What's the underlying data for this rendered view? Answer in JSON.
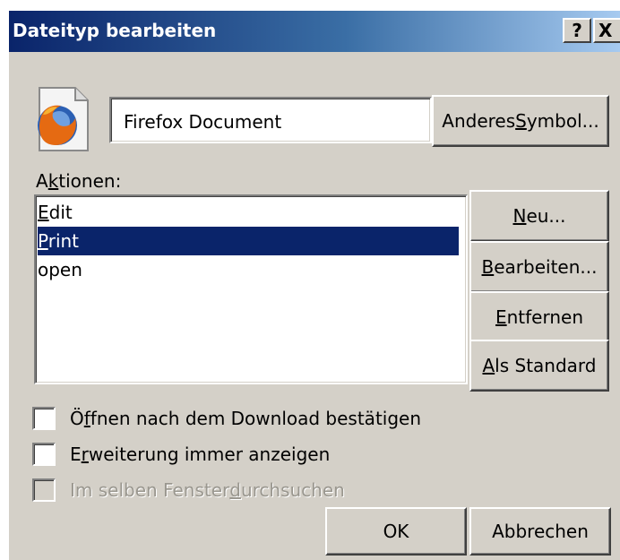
{
  "window": {
    "title": "Dateityp bearbeiten",
    "help_label": "?",
    "close_label": "X"
  },
  "file_type": {
    "icon": "firefox-icon",
    "description": "Firefox Document",
    "change_icon_button": {
      "pre": "Anderes ",
      "accel": "S",
      "post": "ymbol..."
    }
  },
  "actions": {
    "label": {
      "pre": "A",
      "accel": "k",
      "post": "tionen:"
    },
    "items": [
      {
        "accel": "E",
        "rest": "dit",
        "selected": false
      },
      {
        "accel": "P",
        "rest": "rint",
        "selected": true
      },
      {
        "accel": "",
        "rest": "open",
        "selected": false
      }
    ]
  },
  "side_buttons": {
    "new": {
      "pre": "",
      "accel": "N",
      "post": "eu..."
    },
    "edit": {
      "pre": "",
      "accel": "B",
      "post": "earbeiten..."
    },
    "remove": {
      "pre": "",
      "accel": "E",
      "post": "ntfernen"
    },
    "default": {
      "pre": "",
      "accel": "A",
      "post": "ls Standard"
    }
  },
  "options": [
    {
      "pre": "Ö",
      "accel": "f",
      "post": "fnen nach dem Download bestätigen",
      "checked": false,
      "enabled": true
    },
    {
      "pre": "E",
      "accel": "r",
      "post": "weiterung immer anzeigen",
      "checked": false,
      "enabled": true
    },
    {
      "pre": "Im selben Fenster ",
      "accel": "d",
      "post": "urchsuchen",
      "checked": false,
      "enabled": false
    }
  ],
  "footer": {
    "ok_label": "OK",
    "cancel_label": "Abbrechen"
  },
  "colors": {
    "titlebar_start": "#0a246a",
    "titlebar_end": "#a6caf0",
    "face": "#d4d0c8",
    "selection": "#0a246a"
  }
}
